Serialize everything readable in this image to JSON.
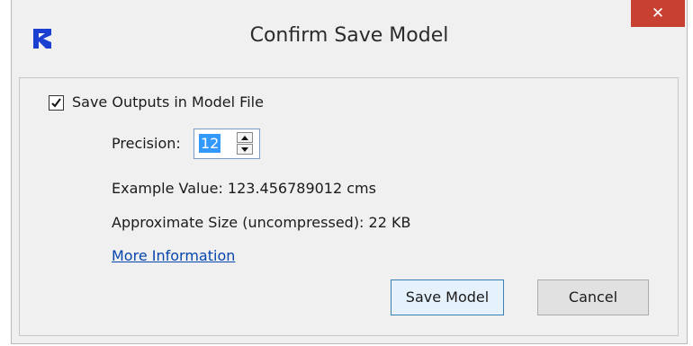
{
  "window": {
    "title": "Confirm Save Model",
    "close_label": "✕",
    "app_icon": "riverware-r-icon",
    "accent_color": "#1a3fd1",
    "close_color": "#c84031"
  },
  "options": {
    "save_outputs_label": "Save Outputs in Model File",
    "save_outputs_checked": true,
    "precision_label": "Precision:",
    "precision_value": "12",
    "example_value_text": "Example Value: 123.456789012 cms",
    "approx_size_text": "Approximate Size (uncompressed): 22 KB",
    "more_info_link": "More Information"
  },
  "buttons": {
    "save_label": "Save Model",
    "cancel_label": "Cancel"
  }
}
